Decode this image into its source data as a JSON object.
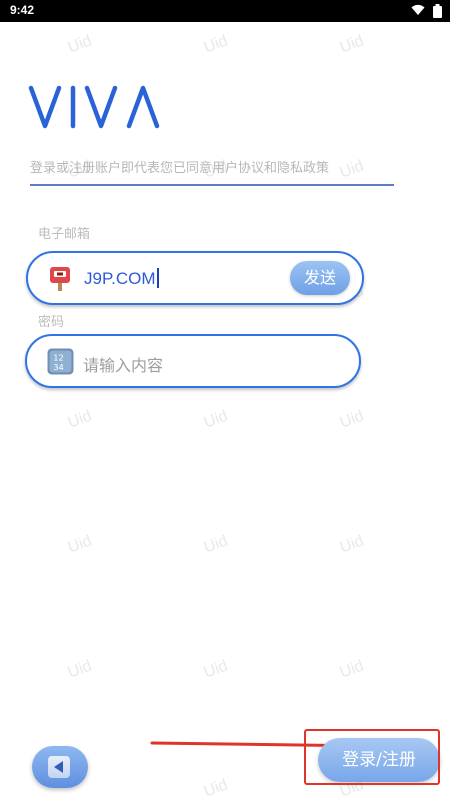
{
  "status_bar": {
    "time": "9:42"
  },
  "brand": {
    "logo_text": "VIVA"
  },
  "agreement": {
    "text": "登录或注册账户即代表您已同意用户协议和隐私政策"
  },
  "email": {
    "label": "电子邮箱",
    "value": "J9P.COM",
    "icon": "mailbox-icon",
    "send_label": "发送"
  },
  "password": {
    "label": "密码",
    "placeholder": "请输入内容",
    "icon": "number-keypad-icon"
  },
  "footer": {
    "back_icon": "back-arrow-icon",
    "login_label": "登录/注册"
  },
  "watermark": {
    "text": "Uid"
  },
  "colors": {
    "accent": "#2f73e6",
    "button_gradient_top": "#a7c8f2",
    "button_gradient_bottom": "#78a6ea",
    "annotation_red": "#e0342a"
  }
}
